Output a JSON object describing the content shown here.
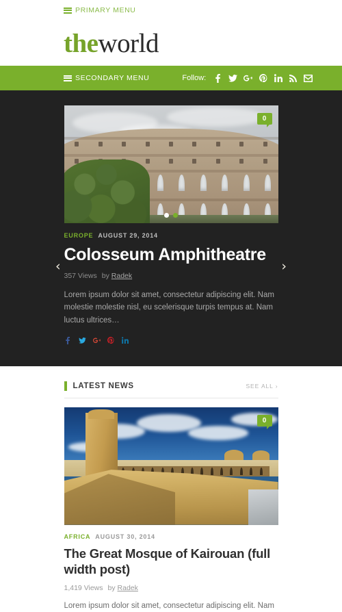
{
  "primary_menu": {
    "label": "PRIMARY MENU",
    "icon": "hamburger-icon"
  },
  "logo": {
    "part1": "the",
    "part2": "world"
  },
  "secondary_menu": {
    "label": "SECONDARY MENU",
    "follow_label": "Follow:",
    "social": [
      {
        "name": "facebook-icon",
        "glyph": "f"
      },
      {
        "name": "twitter-icon",
        "glyph": "t"
      },
      {
        "name": "google-plus-icon",
        "glyph": "g+"
      },
      {
        "name": "pinterest-icon",
        "glyph": "p"
      },
      {
        "name": "linkedin-icon",
        "glyph": "in"
      },
      {
        "name": "rss-icon",
        "glyph": "rss"
      },
      {
        "name": "email-icon",
        "glyph": "mail"
      }
    ]
  },
  "slider": {
    "prev_label": "‹",
    "next_label": "›",
    "comment_count": "0",
    "dots": [
      {
        "active": false
      },
      {
        "active": true
      }
    ],
    "slide": {
      "image_alt": "Colosseum Amphitheatre, Rome",
      "category": "EUROPE",
      "date": "AUGUST 29, 2014",
      "title": "Colosseum Amphitheatre",
      "views": "357 Views",
      "by_label": "by",
      "author": "Radek",
      "excerpt": "Lorem ipsum dolor sit amet, consectetur adipiscing elit. Nam molestie molestie nisl, eu scelerisque turpis tempus at. Nam luctus ultrices…",
      "share": [
        {
          "name": "facebook-share-icon",
          "color": "#3b5998"
        },
        {
          "name": "twitter-share-icon",
          "color": "#2aa9e0"
        },
        {
          "name": "google-plus-share-icon",
          "color": "#d34836"
        },
        {
          "name": "pinterest-share-icon",
          "color": "#cb2027"
        },
        {
          "name": "linkedin-share-icon",
          "color": "#0e76a8"
        }
      ]
    }
  },
  "latest_news": {
    "section_title": "LATEST NEWS",
    "see_all": "SEE ALL ›",
    "posts": [
      {
        "image_alt": "The Great Mosque of Kairouan",
        "comment_count": "0",
        "category": "AFRICA",
        "date": "AUGUST 30, 2014",
        "title": "The Great Mosque of Kairouan (full width post)",
        "views": "1,419 Views",
        "by_label": "by",
        "author": "Radek",
        "excerpt": "Lorem ipsum dolor sit amet, consectetur adipiscing elit. Nam"
      }
    ]
  },
  "colors": {
    "accent_green": "#7ab02c",
    "dark_section": "#222222",
    "logo_green": "#76a32a"
  }
}
